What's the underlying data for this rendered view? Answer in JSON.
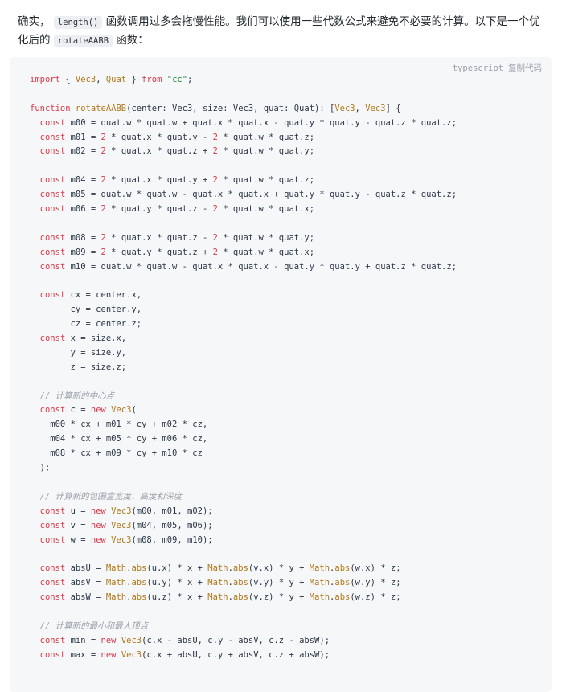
{
  "intro": {
    "text_before": "确实，",
    "code_length": "length()",
    "text_middle": "函数调用过多会拖慢性能。我们可以使用一些代数公式来避免不必要的计算。以下是一个优化后的",
    "code_fn": "rotateAABB",
    "text_after": "函数："
  },
  "code_block": {
    "language": "typescript",
    "copy_label": "复制代码",
    "lines": [
      [
        [
          "kw",
          "import"
        ],
        [
          "p",
          " { "
        ],
        [
          "type",
          "Vec3"
        ],
        [
          "p",
          ", "
        ],
        [
          "type",
          "Quat"
        ],
        [
          "p",
          " } "
        ],
        [
          "kw",
          "from"
        ],
        [
          "p",
          " "
        ],
        [
          "str",
          "\"cc\""
        ],
        [
          "p",
          ";"
        ]
      ],
      [],
      [
        [
          "kw",
          "function"
        ],
        [
          "p",
          " "
        ],
        [
          "fn",
          "rotateAABB"
        ],
        [
          "p",
          "(center: Vec3, size: Vec3, quat: Quat): ["
        ],
        [
          "type",
          "Vec3"
        ],
        [
          "p",
          ", "
        ],
        [
          "type",
          "Vec3"
        ],
        [
          "p",
          "] {"
        ]
      ],
      [
        [
          "p",
          "  "
        ],
        [
          "kw",
          "const"
        ],
        [
          "p",
          " m00 = quat.w * quat.w + quat.x * quat.x - quat.y * quat.y - quat.z * quat.z;"
        ]
      ],
      [
        [
          "p",
          "  "
        ],
        [
          "kw",
          "const"
        ],
        [
          "p",
          " m01 = "
        ],
        [
          "num",
          "2"
        ],
        [
          "p",
          " * quat.x * quat.y - "
        ],
        [
          "num",
          "2"
        ],
        [
          "p",
          " * quat.w * quat.z;"
        ]
      ],
      [
        [
          "p",
          "  "
        ],
        [
          "kw",
          "const"
        ],
        [
          "p",
          " m02 = "
        ],
        [
          "num",
          "2"
        ],
        [
          "p",
          " * quat.x * quat.z + "
        ],
        [
          "num",
          "2"
        ],
        [
          "p",
          " * quat.w * quat.y;"
        ]
      ],
      [],
      [
        [
          "p",
          "  "
        ],
        [
          "kw",
          "const"
        ],
        [
          "p",
          " m04 = "
        ],
        [
          "num",
          "2"
        ],
        [
          "p",
          " * quat.x * quat.y + "
        ],
        [
          "num",
          "2"
        ],
        [
          "p",
          " * quat.w * quat.z;"
        ]
      ],
      [
        [
          "p",
          "  "
        ],
        [
          "kw",
          "const"
        ],
        [
          "p",
          " m05 = quat.w * quat.w - quat.x * quat.x + quat.y * quat.y - quat.z * quat.z;"
        ]
      ],
      [
        [
          "p",
          "  "
        ],
        [
          "kw",
          "const"
        ],
        [
          "p",
          " m06 = "
        ],
        [
          "num",
          "2"
        ],
        [
          "p",
          " * quat.y * quat.z - "
        ],
        [
          "num",
          "2"
        ],
        [
          "p",
          " * quat.w * quat.x;"
        ]
      ],
      [],
      [
        [
          "p",
          "  "
        ],
        [
          "kw",
          "const"
        ],
        [
          "p",
          " m08 = "
        ],
        [
          "num",
          "2"
        ],
        [
          "p",
          " * quat.x * quat.z - "
        ],
        [
          "num",
          "2"
        ],
        [
          "p",
          " * quat.w * quat.y;"
        ]
      ],
      [
        [
          "p",
          "  "
        ],
        [
          "kw",
          "const"
        ],
        [
          "p",
          " m09 = "
        ],
        [
          "num",
          "2"
        ],
        [
          "p",
          " * quat.y * quat.z + "
        ],
        [
          "num",
          "2"
        ],
        [
          "p",
          " * quat.w * quat.x;"
        ]
      ],
      [
        [
          "p",
          "  "
        ],
        [
          "kw",
          "const"
        ],
        [
          "p",
          " m10 = quat.w * quat.w - quat.x * quat.x - quat.y * quat.y + quat.z * quat.z;"
        ]
      ],
      [],
      [
        [
          "p",
          "  "
        ],
        [
          "kw",
          "const"
        ],
        [
          "p",
          " cx = center.x,"
        ]
      ],
      [
        [
          "p",
          "        cy = center.y,"
        ]
      ],
      [
        [
          "p",
          "        cz = center.z;"
        ]
      ],
      [
        [
          "p",
          "  "
        ],
        [
          "kw",
          "const"
        ],
        [
          "p",
          " x = size.x,"
        ]
      ],
      [
        [
          "p",
          "        y = size.y,"
        ]
      ],
      [
        [
          "p",
          "        z = size.z;"
        ]
      ],
      [],
      [
        [
          "p",
          "  "
        ],
        [
          "cm",
          "// 计算新的中心点"
        ]
      ],
      [
        [
          "p",
          "  "
        ],
        [
          "kw",
          "const"
        ],
        [
          "p",
          " c = "
        ],
        [
          "kw",
          "new"
        ],
        [
          "p",
          " "
        ],
        [
          "type",
          "Vec3"
        ],
        [
          "p",
          "("
        ]
      ],
      [
        [
          "p",
          "    m00 * cx + m01 * cy + m02 * cz,"
        ]
      ],
      [
        [
          "p",
          "    m04 * cx + m05 * cy + m06 * cz,"
        ]
      ],
      [
        [
          "p",
          "    m08 * cx + m09 * cy + m10 * cz"
        ]
      ],
      [
        [
          "p",
          "  );"
        ]
      ],
      [],
      [
        [
          "p",
          "  "
        ],
        [
          "cm",
          "// 计算新的包围盒宽度、高度和深度"
        ]
      ],
      [
        [
          "p",
          "  "
        ],
        [
          "kw",
          "const"
        ],
        [
          "p",
          " u = "
        ],
        [
          "kw",
          "new"
        ],
        [
          "p",
          " "
        ],
        [
          "type",
          "Vec3"
        ],
        [
          "p",
          "(m00, m01, m02);"
        ]
      ],
      [
        [
          "p",
          "  "
        ],
        [
          "kw",
          "const"
        ],
        [
          "p",
          " v = "
        ],
        [
          "kw",
          "new"
        ],
        [
          "p",
          " "
        ],
        [
          "type",
          "Vec3"
        ],
        [
          "p",
          "(m04, m05, m06);"
        ]
      ],
      [
        [
          "p",
          "  "
        ],
        [
          "kw",
          "const"
        ],
        [
          "p",
          " w = "
        ],
        [
          "kw",
          "new"
        ],
        [
          "p",
          " "
        ],
        [
          "type",
          "Vec3"
        ],
        [
          "p",
          "(m08, m09, m10);"
        ]
      ],
      [],
      [
        [
          "p",
          "  "
        ],
        [
          "kw",
          "const"
        ],
        [
          "p",
          " absU = "
        ],
        [
          "type",
          "Math"
        ],
        [
          "p",
          "."
        ],
        [
          "fn",
          "abs"
        ],
        [
          "p",
          "(u.x) * x + "
        ],
        [
          "type",
          "Math"
        ],
        [
          "p",
          "."
        ],
        [
          "fn",
          "abs"
        ],
        [
          "p",
          "(v.x) * y + "
        ],
        [
          "type",
          "Math"
        ],
        [
          "p",
          "."
        ],
        [
          "fn",
          "abs"
        ],
        [
          "p",
          "(w.x) * z;"
        ]
      ],
      [
        [
          "p",
          "  "
        ],
        [
          "kw",
          "const"
        ],
        [
          "p",
          " absV = "
        ],
        [
          "type",
          "Math"
        ],
        [
          "p",
          "."
        ],
        [
          "fn",
          "abs"
        ],
        [
          "p",
          "(u.y) * x + "
        ],
        [
          "type",
          "Math"
        ],
        [
          "p",
          "."
        ],
        [
          "fn",
          "abs"
        ],
        [
          "p",
          "(v.y) * y + "
        ],
        [
          "type",
          "Math"
        ],
        [
          "p",
          "."
        ],
        [
          "fn",
          "abs"
        ],
        [
          "p",
          "(w.y) * z;"
        ]
      ],
      [
        [
          "p",
          "  "
        ],
        [
          "kw",
          "const"
        ],
        [
          "p",
          " absW = "
        ],
        [
          "type",
          "Math"
        ],
        [
          "p",
          "."
        ],
        [
          "fn",
          "abs"
        ],
        [
          "p",
          "(u.z) * x + "
        ],
        [
          "type",
          "Math"
        ],
        [
          "p",
          "."
        ],
        [
          "fn",
          "abs"
        ],
        [
          "p",
          "(v.z) * y + "
        ],
        [
          "type",
          "Math"
        ],
        [
          "p",
          "."
        ],
        [
          "fn",
          "abs"
        ],
        [
          "p",
          "(w.z) * z;"
        ]
      ],
      [],
      [
        [
          "p",
          "  "
        ],
        [
          "cm",
          "// 计算新的最小和最大顶点"
        ]
      ],
      [
        [
          "p",
          "  "
        ],
        [
          "kw",
          "const"
        ],
        [
          "p",
          " min = "
        ],
        [
          "kw",
          "new"
        ],
        [
          "p",
          " "
        ],
        [
          "type",
          "Vec3"
        ],
        [
          "p",
          "(c.x - absU, c.y - absV, c.z - absW);"
        ]
      ],
      [
        [
          "p",
          "  "
        ],
        [
          "kw",
          "const"
        ],
        [
          "p",
          " max = "
        ],
        [
          "kw",
          "new"
        ],
        [
          "p",
          " "
        ],
        [
          "type",
          "Vec3"
        ],
        [
          "p",
          "(c.x + absU, c.y + absV, c.z + absW);"
        ]
      ]
    ]
  }
}
